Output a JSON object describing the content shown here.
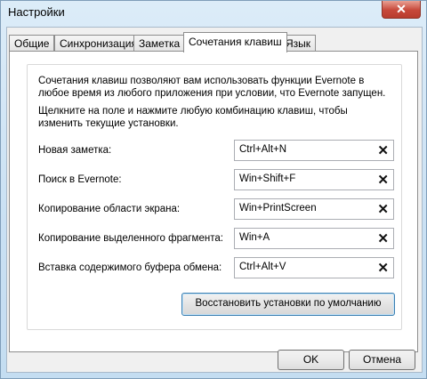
{
  "window": {
    "title": "Настройки",
    "close_glyph": "✕"
  },
  "tabs": [
    {
      "label": "Общие",
      "active": false
    },
    {
      "label": "Синхронизация",
      "active": false
    },
    {
      "label": "Заметка",
      "active": false
    },
    {
      "label": "Сочетания клавиш",
      "active": true
    },
    {
      "label": "Язык",
      "active": false
    }
  ],
  "panel": {
    "description_1": "Сочетания клавиш позволяют вам использовать функции Evernote в любое время из любого приложения при условии, что Evernote запущен.",
    "description_2": "Щелкните на поле и нажмите любую комбинацию клавиш, чтобы изменить текущие установки.",
    "hotkeys": [
      {
        "label": "Новая заметка:",
        "value": "Ctrl+Alt+N"
      },
      {
        "label": "Поиск в Evernote:",
        "value": "Win+Shift+F"
      },
      {
        "label": "Копирование области экрана:",
        "value": "Win+PrintScreen"
      },
      {
        "label": "Копирование выделенного фрагмента:",
        "value": "Win+A"
      },
      {
        "label": "Вставка содержимого буфера обмена:",
        "value": "Ctrl+Alt+V"
      }
    ],
    "clear_glyph": "✕",
    "restore_label": "Восстановить установки по умолчанию"
  },
  "buttons": {
    "ok": "OK",
    "cancel": "Отмена"
  },
  "colors": {
    "title_bar": "#c9e0f3",
    "close_button": "#c7483a",
    "focus_border": "#3c7fb1"
  }
}
